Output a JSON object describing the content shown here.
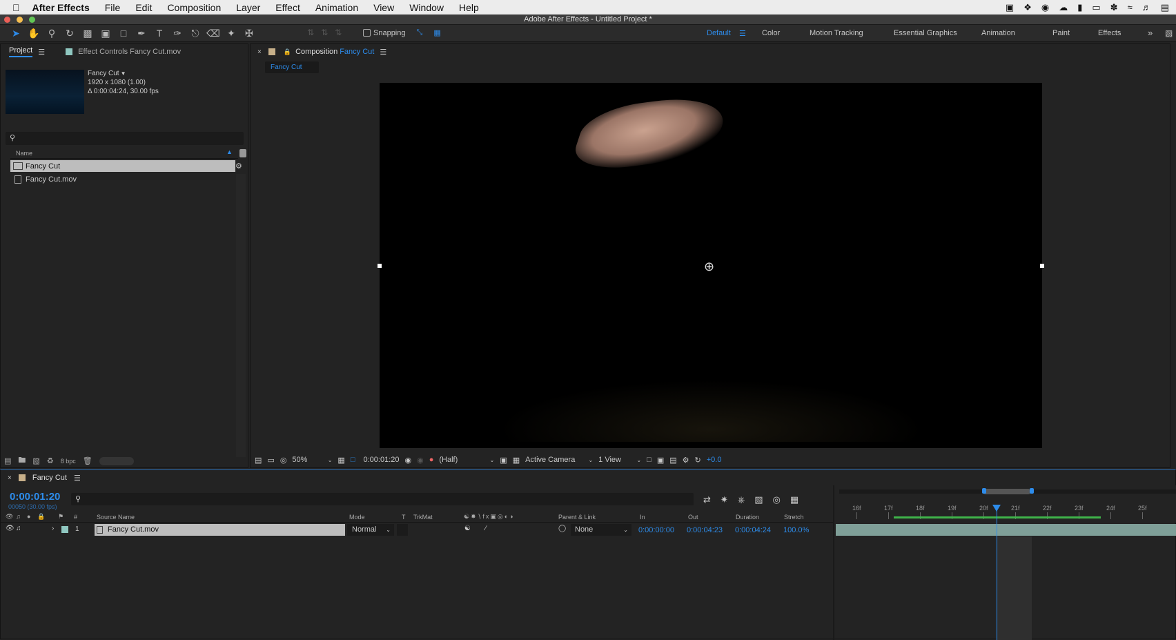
{
  "menubar": {
    "app_name": "After Effects",
    "items": [
      "File",
      "Edit",
      "Composition",
      "Layer",
      "Effect",
      "Animation",
      "View",
      "Window",
      "Help"
    ]
  },
  "window": {
    "title": "Adobe After Effects - Untitled Project *"
  },
  "toolbar": {
    "snapping_label": "Snapping",
    "workspaces": [
      "Default",
      "Color",
      "Motion Tracking",
      "Essential Graphics",
      "Animation",
      "Paint",
      "Effects"
    ],
    "active_workspace": "Default"
  },
  "project_panel": {
    "tab_label": "Project",
    "effect_controls_label": "Effect Controls Fancy Cut.mov",
    "preview": {
      "name": "Fancy Cut",
      "dims": "1920 x 1080 (1.00)",
      "duration": "Δ 0:00:04:24, 30.00 fps"
    },
    "search_placeholder": "",
    "column_name": "Name",
    "items": [
      {
        "name": "Fancy Cut",
        "type": "composition",
        "selected": true
      },
      {
        "name": "Fancy Cut.mov",
        "type": "footage",
        "selected": false
      }
    ],
    "bpc_label": "8 bpc"
  },
  "comp_panel": {
    "tab_prefix": "Composition",
    "tab_comp_name": "Fancy Cut",
    "breadcrumb": "Fancy Cut",
    "zoom": "50%",
    "timecode": "0:00:01:20",
    "resolution": "(Half)",
    "camera": "Active Camera",
    "views": "1 View",
    "exposure": "+0.0"
  },
  "timeline": {
    "tab_label": "Fancy Cut",
    "current_time": "0:00:01:20",
    "frame_info": "00050 (30.00 fps)",
    "columns": {
      "source_name": "Source Name",
      "mode": "Mode",
      "t": "T",
      "trkmat": "TrkMat",
      "parent": "Parent & Link",
      "in": "In",
      "out": "Out",
      "duration": "Duration",
      "stretch": "Stretch",
      "hash": "#"
    },
    "layers": [
      {
        "index": "1",
        "name": "Fancy Cut.mov",
        "mode": "Normal",
        "parent": "None",
        "in": "0:00:00:00",
        "out": "0:00:04:23",
        "duration": "0:00:04:24",
        "stretch": "100.0%"
      }
    ],
    "ruler_labels": [
      "16f",
      "17f",
      "18f",
      "19f",
      "20f",
      "21f",
      "22f",
      "23f",
      "24f",
      "25f"
    ]
  },
  "colors": {
    "accent": "#2d8ceb",
    "panel_bg": "#232323",
    "layer_bar": "#8fb5ad",
    "work_area_green": "#3fb44a"
  }
}
